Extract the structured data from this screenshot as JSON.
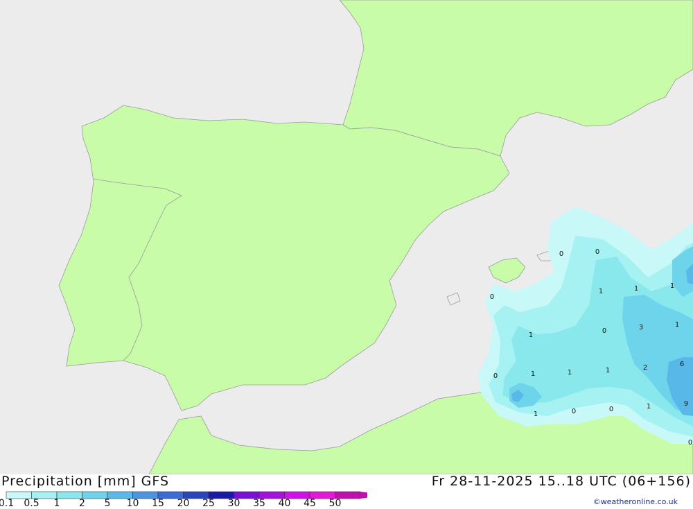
{
  "header": {
    "title_left": "Precipitation [mm] GFS",
    "title_right": "Fr 28-11-2025 15..18 UTC (06+156)",
    "credit": "©weatheronline.co.uk"
  },
  "legend": {
    "labels": [
      "0.1",
      "0.5",
      "1",
      "2",
      "5",
      "10",
      "15",
      "20",
      "25",
      "30",
      "35",
      "40",
      "45",
      "50"
    ],
    "colors": [
      "#c8f8f8",
      "#a6f2f2",
      "#88e8ec",
      "#6ed4ec",
      "#58b8e8",
      "#4a94e0",
      "#3a6cd8",
      "#2a44c0",
      "#1a1aa8",
      "#7a10d8",
      "#a810e0",
      "#d010e8",
      "#e418d8",
      "#c010b0"
    ]
  },
  "colors": {
    "sea": "#ececec",
    "land": "#c8fca8",
    "border": "#9a9a9a"
  },
  "map_labels": [
    "0",
    "0",
    "0",
    "1",
    "1",
    "1",
    "3",
    "1",
    "1",
    "0",
    "1",
    "1",
    "1",
    "2",
    "6",
    "0",
    "1",
    "0",
    "0",
    "1",
    "9",
    "0"
  ]
}
